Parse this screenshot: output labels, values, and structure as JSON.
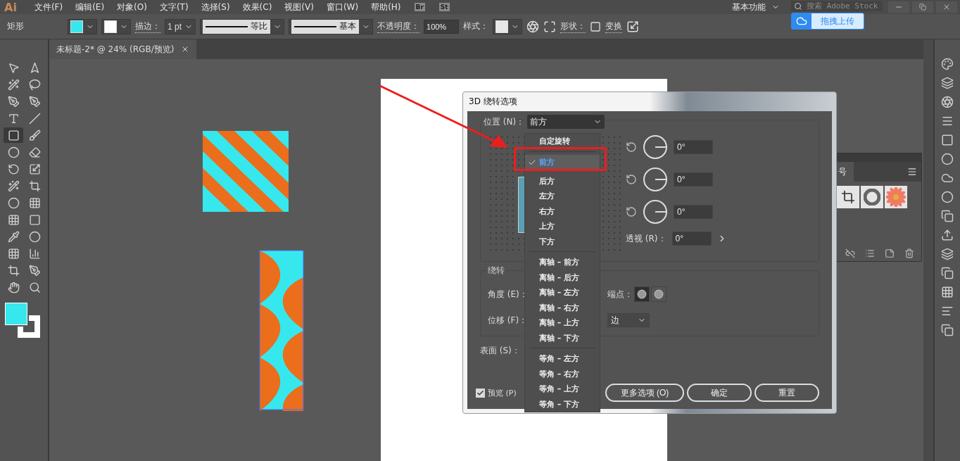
{
  "menu_bar": {
    "logo": "Ai",
    "items": [
      "文件(F)",
      "编辑(E)",
      "对象(O)",
      "文字(T)",
      "选择(S)",
      "效果(C)",
      "视图(V)",
      "窗口(W)",
      "帮助(H)"
    ],
    "bridge": "Br",
    "stock": "St",
    "workspace": "基本功能",
    "search": {
      "placeholder": "搜索 Adobe Stock"
    }
  },
  "upload_button": "拖拽上传",
  "control_bar": {
    "tool": "矩形",
    "stroke_label": "描边：",
    "stroke_weight": "1 pt",
    "profile": "等比",
    "brush": "基本",
    "opacity_label": "不透明度：",
    "opacity": "100%",
    "style_label": "样式：",
    "shape_label": "形状：",
    "transform_label": "变换"
  },
  "document_tab": {
    "title": "未标题-2* @ 24% (RGB/预览)"
  },
  "symbols_panel": {
    "tab": "号"
  },
  "dialog": {
    "title": "3D 绕转选项",
    "position_label": "位置 (N)：",
    "position_value": "前方",
    "menu_groups": [
      [
        {
          "label": "自定旋转",
          "selected": false
        }
      ],
      [
        {
          "label": "前方",
          "selected": true
        },
        {
          "label": "后方",
          "selected": false
        },
        {
          "label": "左方",
          "selected": false
        },
        {
          "label": "右方",
          "selected": false
        },
        {
          "label": "上方",
          "selected": false
        },
        {
          "label": "下方",
          "selected": false
        }
      ],
      [
        {
          "label": "离轴 – 前方",
          "selected": false
        },
        {
          "label": "离轴 – 后方",
          "selected": false
        },
        {
          "label": "离轴 – 左方",
          "selected": false
        },
        {
          "label": "离轴 – 右方",
          "selected": false
        },
        {
          "label": "离轴 – 上方",
          "selected": false
        },
        {
          "label": "离轴 – 下方",
          "selected": false
        }
      ],
      [
        {
          "label": "等角 – 左方",
          "selected": false
        },
        {
          "label": "等角 – 右方",
          "selected": false
        },
        {
          "label": "等角 – 上方",
          "selected": false
        },
        {
          "label": "等角 – 下方",
          "selected": false
        }
      ]
    ],
    "rotation_fields": [
      "0°",
      "0°",
      "0°"
    ],
    "perspective_label": "透视 (R)：",
    "perspective_value": "0°",
    "revolve_section": "绕转",
    "angle_label": "角度 (E)：",
    "cap_label": "端点：",
    "caps": [
      {
        "selected": true
      },
      {
        "selected": false
      }
    ],
    "offset_label": "位移 (F)：",
    "offset_value": "边",
    "surface_label": "表面 (S)：",
    "preview": {
      "label": "预览 (P)",
      "checked": true
    },
    "buttons": [
      "更多选项 (O)",
      "确定",
      "重置"
    ]
  }
}
